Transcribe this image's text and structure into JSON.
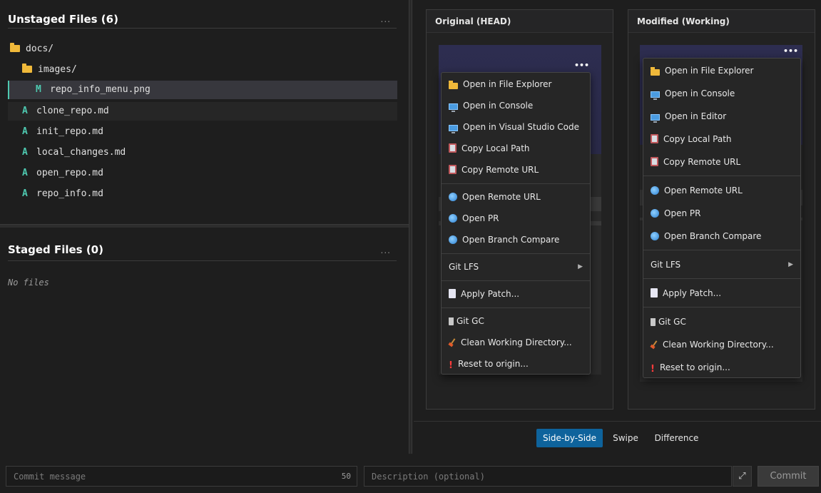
{
  "unstaged": {
    "title": "Unstaged Files (6)",
    "more": "...",
    "items": [
      {
        "type": "folder",
        "name": "docs/"
      },
      {
        "type": "folder",
        "name": "images/"
      },
      {
        "type": "file",
        "status": "M",
        "name": "repo_info_menu.png"
      },
      {
        "type": "file",
        "status": "A",
        "name": "clone_repo.md"
      },
      {
        "type": "file",
        "status": "A",
        "name": "init_repo.md"
      },
      {
        "type": "file",
        "status": "A",
        "name": "local_changes.md"
      },
      {
        "type": "file",
        "status": "A",
        "name": "open_repo.md"
      },
      {
        "type": "file",
        "status": "A",
        "name": "repo_info.md"
      }
    ]
  },
  "staged": {
    "title": "Staged Files (0)",
    "more": "...",
    "empty": "No files"
  },
  "diff": {
    "original_title": "Original (HEAD)",
    "modified_title": "Modified (Working)",
    "dots": "•••",
    "original_menu": [
      {
        "icon": "folder-icon",
        "label": "Open in File Explorer"
      },
      {
        "icon": "computer-icon",
        "label": "Open in Console"
      },
      {
        "icon": "computer-icon",
        "label": "Open in Visual Studio Code"
      },
      {
        "icon": "clipboard-icon",
        "label": "Copy Local Path"
      },
      {
        "icon": "clipboard-icon",
        "label": "Copy Remote URL"
      },
      {
        "icon": "globe-icon",
        "label": "Open Remote URL"
      },
      {
        "icon": "globe-icon",
        "label": "Open PR"
      },
      {
        "icon": "globe-icon",
        "label": "Open Branch Compare"
      },
      {
        "icon": "",
        "label": "Git LFS"
      },
      {
        "icon": "page-icon",
        "label": "Apply Patch..."
      },
      {
        "icon": "trash-icon",
        "label": "Git GC"
      },
      {
        "icon": "broom-icon",
        "label": "Clean Working Directory..."
      },
      {
        "icon": "exclamation-icon",
        "label": "Reset to origin..."
      }
    ],
    "modified_menu": [
      {
        "icon": "folder-icon",
        "label": "Open in File Explorer"
      },
      {
        "icon": "computer-icon",
        "label": "Open in Console"
      },
      {
        "icon": "computer-icon",
        "label": "Open in Editor"
      },
      {
        "icon": "clipboard-icon",
        "label": "Copy Local Path"
      },
      {
        "icon": "clipboard-icon",
        "label": "Copy Remote URL"
      },
      {
        "icon": "globe-icon",
        "label": "Open Remote URL"
      },
      {
        "icon": "globe-icon",
        "label": "Open PR"
      },
      {
        "icon": "globe-icon",
        "label": "Open Branch Compare"
      },
      {
        "icon": "",
        "label": "Git LFS"
      },
      {
        "icon": "page-icon",
        "label": "Apply Patch..."
      },
      {
        "icon": "trash-icon",
        "label": "Git GC"
      },
      {
        "icon": "broom-icon",
        "label": "Clean Working Directory..."
      },
      {
        "icon": "exclamation-icon",
        "label": "Reset to origin..."
      }
    ],
    "submenu_arrow": "▶",
    "view_modes": [
      "Side-by-Side",
      "Swipe",
      "Difference"
    ],
    "active_mode": "Side-by-Side"
  },
  "commit": {
    "message_placeholder": "Commit message",
    "message_count": "50",
    "description_placeholder": "Description (optional)",
    "expand_glyph": "⤢",
    "commit_label": "Commit"
  }
}
